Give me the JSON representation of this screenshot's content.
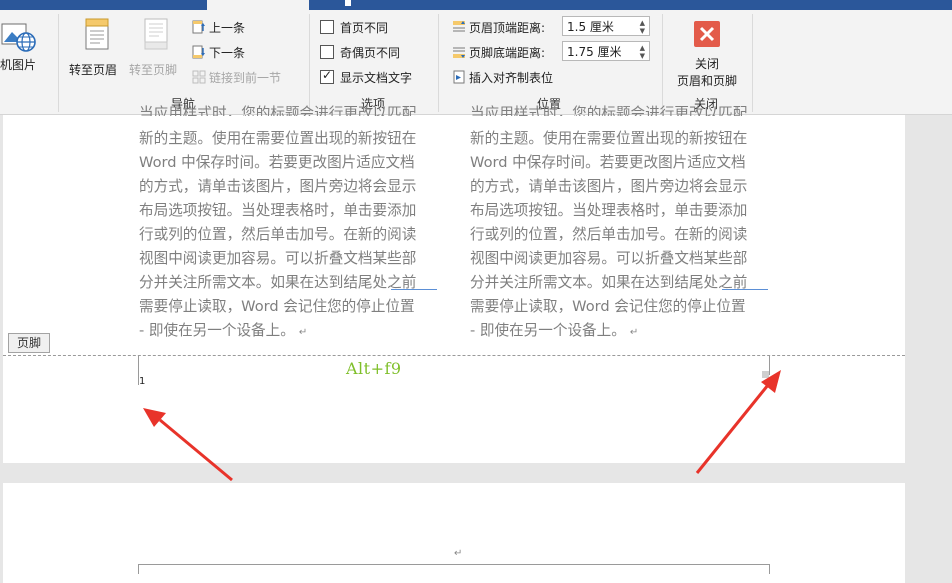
{
  "ribbon": {
    "picture_btn": "机图片",
    "nav": {
      "goto_header": "转至页眉",
      "goto_footer": "转至页脚",
      "prev": "上一条",
      "next": "下一条",
      "link_prev": "链接到前一节",
      "label": "导航"
    },
    "options": {
      "first_page": "首页不同",
      "odd_even": "奇偶页不同",
      "show_text": "显示文档文字",
      "show_text_checked": true,
      "label": "选项"
    },
    "position": {
      "header_top_label": "页眉顶端距离:",
      "header_top_value": "1.5 厘米",
      "footer_bottom_label": "页脚底端距离:",
      "footer_bottom_value": "1.75 厘米",
      "insert_align_tab": "插入对齐制表位",
      "label": "位置"
    },
    "close": {
      "line1": "关闭",
      "line2": "页眉和页脚",
      "label": "关闭"
    }
  },
  "document": {
    "left_col": {
      "top_clip": "当应用样式时，您的标题会进行更改以匹配",
      "lines": [
        "新的主题。使用在需要位置出现的新按钮在",
        "Word 中保存时间。若要更改图片适应文档",
        "的方式，请单击该图片，图片旁边将会显示",
        "布局选项按钮。当处理表格时，单击要添加",
        "行或列的位置，然后单击加号。在新的阅读",
        "视图中阅读更加容易。可以折叠文档某些部",
        "分并关注所需文本。如果在达到结尾处之前",
        "需要停止读取，Word 会记住您的停止位置",
        "- 即使在另一个设备上。"
      ]
    },
    "right_col": {
      "top_clip": "当应用样式时，您的标题会进行更改以匹配",
      "lines": [
        "新的主题。使用在需要位置出现的新按钮在",
        "Word 中保存时间。若要更改图片适应文档",
        "的方式，请单击该图片，图片旁边将会显示",
        "布局选项按钮。当处理表格时，单击要添加",
        "行或列的位置，然后单击加号。在新的阅读",
        "视图中阅读更加容易。可以折叠文档某些部",
        "分并关注所需文本。如果在达到结尾处之前",
        "需要停止读取，Word 会记住您的停止位置",
        "- 即使在另一个设备上。"
      ]
    },
    "footer_tab": "页脚",
    "page_number": "1",
    "shortcut_annotation": "Alt+f9",
    "paragraph_mark": "↵"
  },
  "colors": {
    "title_blue": "#2b579a",
    "annotation_green": "#7fbf2a",
    "arrow_red": "#e8332a",
    "close_red": "#e35b4a"
  }
}
